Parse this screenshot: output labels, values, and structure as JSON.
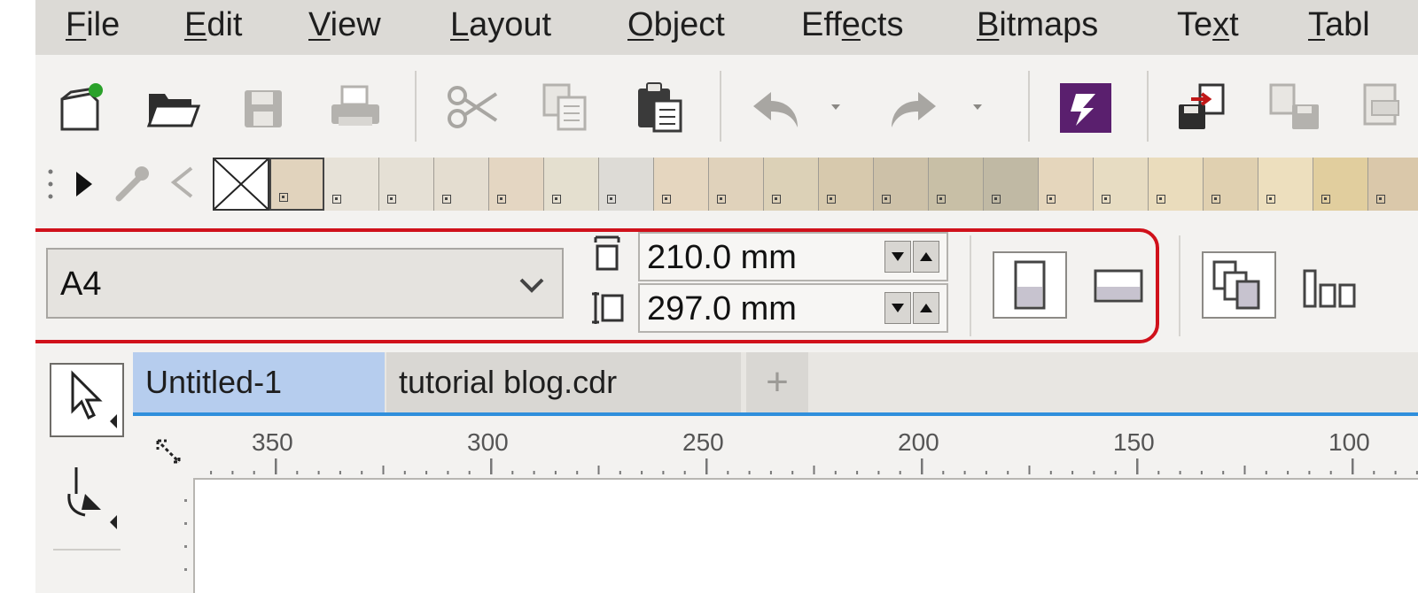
{
  "menubar": {
    "items": [
      {
        "pre": "",
        "u": "F",
        "post": "ile"
      },
      {
        "pre": "",
        "u": "E",
        "post": "dit"
      },
      {
        "pre": "",
        "u": "V",
        "post": "iew"
      },
      {
        "pre": "",
        "u": "L",
        "post": "ayout"
      },
      {
        "pre": "",
        "u": "O",
        "post": "bject"
      },
      {
        "pre": "Eff",
        "u": "e",
        "post": "cts"
      },
      {
        "pre": "",
        "u": "B",
        "post": "itmaps"
      },
      {
        "pre": "Te",
        "u": "x",
        "post": "t"
      },
      {
        "pre": "",
        "u": "T",
        "post": "abl"
      }
    ]
  },
  "toolbar": {
    "icons": [
      "new-document-icon",
      "open-folder-icon",
      "save-icon",
      "print-icon",
      "cut-icon",
      "copy-icon",
      "paste-icon",
      "undo-icon",
      "redo-icon",
      "corel-connect-icon",
      "import-icon",
      "export-icon",
      "publish-pdf-icon"
    ]
  },
  "palette": {
    "colors": [
      "#e1d3bd",
      "#e7e2d8",
      "#e5e0d5",
      "#e4ddd0",
      "#e4d6c2",
      "#e4dfcf",
      "#dddbd6",
      "#e5d6bf",
      "#e0d2bb",
      "#dcd1b7",
      "#d7c9ad",
      "#cdc1a8",
      "#c8bfa6",
      "#c0b9a4",
      "#e5d6bc",
      "#e7dcc2",
      "#eadcbc",
      "#e0d0b0",
      "#eddfbe",
      "#e1ce9e",
      "#dac8aa"
    ]
  },
  "propbar": {
    "page_size": "A4",
    "width": "210.0 mm",
    "height": "297.0 mm"
  },
  "tabs": [
    {
      "label": "Untitled-1"
    },
    {
      "label": "tutorial blog.cdr"
    },
    {
      "label": "+"
    }
  ],
  "ruler": {
    "labels": [
      "350",
      "300",
      "250",
      "200",
      "150",
      "100"
    ]
  },
  "colors": {
    "highlight": "#d0111b",
    "active_tab": "#b6cdee",
    "tab_underline": "#2f8fdc"
  }
}
